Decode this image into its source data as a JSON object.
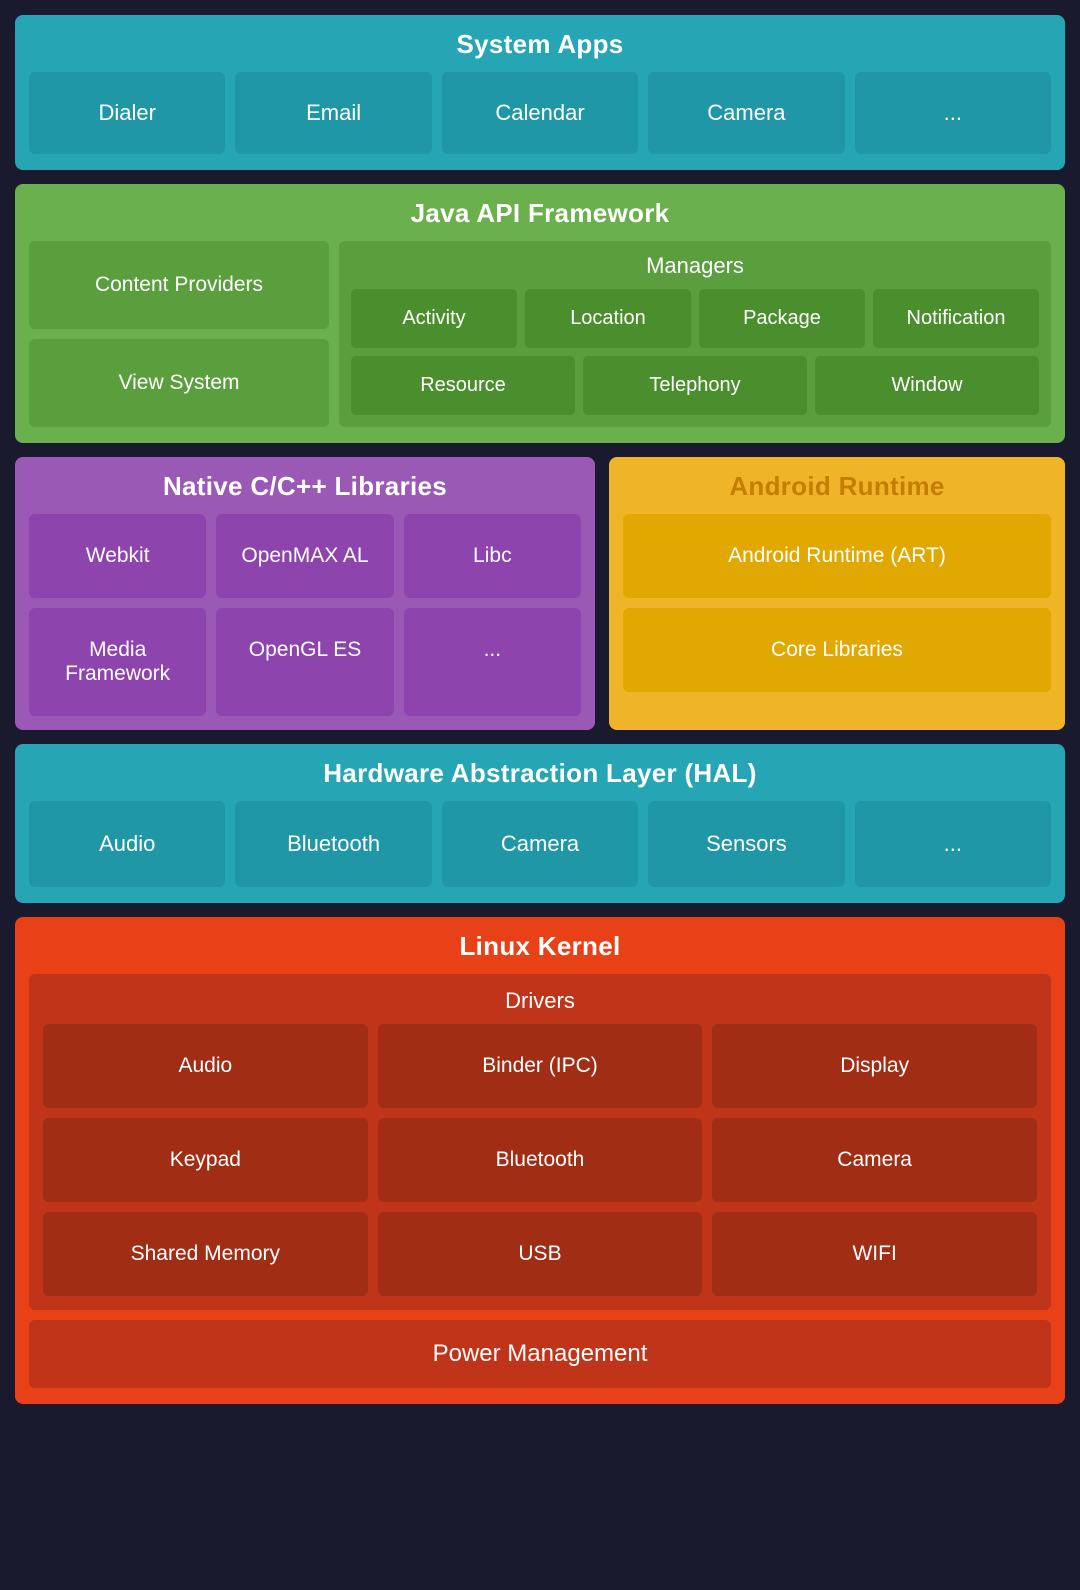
{
  "system_apps": {
    "title": "System Apps",
    "apps": [
      "Dialer",
      "Email",
      "Calendar",
      "Camera",
      "..."
    ]
  },
  "java_api": {
    "title": "Java API Framework",
    "left_items": [
      "Content Providers",
      "View System"
    ],
    "managers": {
      "title": "Managers",
      "row1": [
        "Activity",
        "Location",
        "Package",
        "Notification"
      ],
      "row2": [
        "Resource",
        "Telephony",
        "Window"
      ]
    }
  },
  "native_cpp": {
    "title": "Native C/C++ Libraries",
    "items": [
      "Webkit",
      "OpenMAX AL",
      "Libc",
      "Media Framework",
      "OpenGL ES",
      "..."
    ]
  },
  "android_runtime": {
    "title": "Android Runtime",
    "items": [
      "Android Runtime (ART)",
      "Core Libraries"
    ]
  },
  "hal": {
    "title": "Hardware Abstraction Layer (HAL)",
    "items": [
      "Audio",
      "Bluetooth",
      "Camera",
      "Sensors",
      "..."
    ]
  },
  "linux_kernel": {
    "title": "Linux Kernel",
    "drivers_title": "Drivers",
    "drivers": [
      "Audio",
      "Binder (IPC)",
      "Display",
      "Keypad",
      "Bluetooth",
      "Camera",
      "Shared Memory",
      "USB",
      "WIFI"
    ],
    "power_management": "Power Management"
  }
}
